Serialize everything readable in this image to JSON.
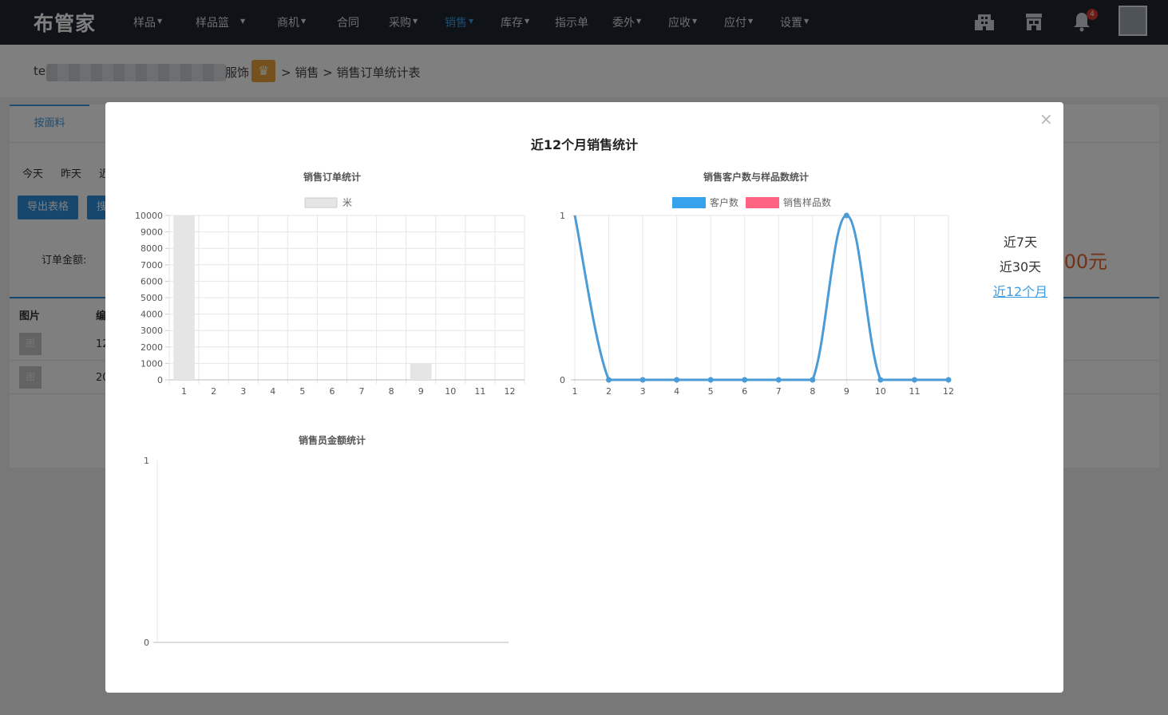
{
  "app": {
    "logo": "布管家"
  },
  "nav": {
    "items": [
      {
        "label": "样品",
        "caret": true,
        "active": false
      },
      {
        "label": "样品篮",
        "caret": true,
        "active": false
      },
      {
        "label": "商机",
        "caret": true,
        "active": false
      },
      {
        "label": "合同",
        "caret": false,
        "active": false
      },
      {
        "label": "采购",
        "caret": true,
        "active": false
      },
      {
        "label": "销售",
        "caret": true,
        "active": true
      },
      {
        "label": "库存",
        "caret": true,
        "active": false
      },
      {
        "label": "指示单",
        "caret": false,
        "active": false
      },
      {
        "label": "委外",
        "caret": true,
        "active": false
      },
      {
        "label": "应收",
        "caret": true,
        "active": false
      },
      {
        "label": "应付",
        "caret": true,
        "active": false
      },
      {
        "label": "设置",
        "caret": true,
        "active": false
      }
    ],
    "icons": [
      "building-icon",
      "store-icon",
      "bell-icon"
    ],
    "notification_count": "4"
  },
  "breadcrumb": {
    "user_prefix": "te",
    "shop_suffix": "服饰",
    "path": "> 销售 > 销售订单统计表"
  },
  "page": {
    "tab": "按面料",
    "quick_filters": [
      "今天",
      "昨天",
      "近"
    ],
    "buttons": [
      "导出表格",
      "搜"
    ],
    "amount_label": "订单金额:",
    "amount_value": ".00元",
    "table": {
      "headers": [
        "图片",
        "编"
      ],
      "rows": [
        {
          "thumb": "图",
          "code": "12"
        },
        {
          "thumb": "图",
          "code": "20"
        }
      ]
    }
  },
  "modal": {
    "title": "近12个月销售统计",
    "close_symbol": "×",
    "ranges": [
      {
        "label": "近7天",
        "active": false
      },
      {
        "label": "近30天",
        "active": false
      },
      {
        "label": "近12个月",
        "active": true
      }
    ]
  },
  "colors": {
    "nav_bg": "#1f252c",
    "accent": "#3d9be0",
    "customer_series": "#36a2eb",
    "sample_series": "#ff6384",
    "bar_fill": "#e5e5e5",
    "amount": "#e7652f"
  },
  "chart_data": [
    {
      "type": "bar",
      "title": "销售订单统计",
      "categories": [
        "1",
        "2",
        "3",
        "4",
        "5",
        "6",
        "7",
        "8",
        "9",
        "10",
        "11",
        "12"
      ],
      "series": [
        {
          "name": "米",
          "values": [
            10000,
            0,
            0,
            0,
            0,
            0,
            0,
            0,
            1000,
            0,
            0,
            0
          ]
        }
      ],
      "ylim": [
        0,
        10000
      ],
      "yticks": [
        0,
        1000,
        2000,
        3000,
        4000,
        5000,
        6000,
        7000,
        8000,
        9000,
        10000
      ],
      "legend": "top",
      "grid": true
    },
    {
      "type": "line",
      "title": "销售客户数与样品数统计",
      "categories": [
        "1",
        "2",
        "3",
        "4",
        "5",
        "6",
        "7",
        "8",
        "9",
        "10",
        "11",
        "12"
      ],
      "series": [
        {
          "name": "客户数",
          "values": [
            1,
            0,
            0,
            0,
            0,
            0,
            0,
            0,
            1,
            0,
            0,
            0
          ]
        },
        {
          "name": "销售样品数",
          "values": []
        }
      ],
      "ylim": [
        0,
        1
      ],
      "yticks": [
        0,
        1
      ],
      "legend": "top",
      "grid": true
    },
    {
      "type": "bar",
      "title": "销售员金额统计",
      "categories": [],
      "series": [],
      "ylim": [
        0,
        1
      ],
      "yticks": [
        0,
        1
      ],
      "grid": false
    }
  ]
}
